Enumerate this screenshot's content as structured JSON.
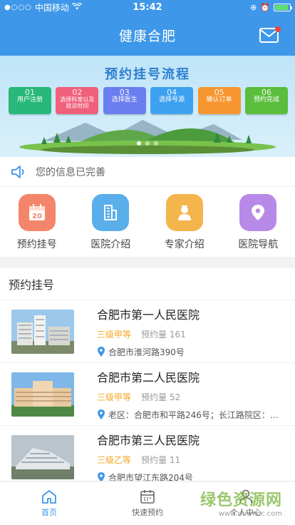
{
  "status_bar": {
    "signal": "●○○○",
    "carrier": "中国移动",
    "time": "15:42"
  },
  "header": {
    "title": "健康合肥"
  },
  "banner": {
    "title": "预约挂号流程",
    "steps": [
      {
        "num": "01",
        "label": "用户注册",
        "color": "#27b87a"
      },
      {
        "num": "02",
        "label": "选择科室以及就诊时间",
        "color": "#f0607a"
      },
      {
        "num": "03",
        "label": "选择医生",
        "color": "#6a7ef0"
      },
      {
        "num": "04",
        "label": "选择号源",
        "color": "#3da1f0"
      },
      {
        "num": "05",
        "label": "确认订单",
        "color": "#f79530"
      },
      {
        "num": "06",
        "label": "预约完成",
        "color": "#5bbd3c"
      }
    ]
  },
  "notice": {
    "text": "您的信息已完善"
  },
  "quick_menu": [
    {
      "label": "预约挂号",
      "icon": "calendar-icon",
      "color": "#f4856a"
    },
    {
      "label": "医院介绍",
      "icon": "building-icon",
      "color": "#5aaeea"
    },
    {
      "label": "专家介绍",
      "icon": "doctor-icon",
      "color": "#f4b54c"
    },
    {
      "label": "医院导航",
      "icon": "location-pin-icon",
      "color": "#b68ae6"
    }
  ],
  "section": {
    "title": "预约挂号",
    "hospitals": [
      {
        "name": "合肥市第一人民医院",
        "level": "三级甲等",
        "count_label": "预约量",
        "count": "161",
        "address": "合肥市淮河路390号"
      },
      {
        "name": "合肥市第二人民医院",
        "level": "三级甲等",
        "count_label": "预约量",
        "count": "52",
        "address": "老区：合肥市和平路246号；长江路院区：长..."
      },
      {
        "name": "合肥市第三人民医院",
        "level": "三级乙等",
        "count_label": "预约量",
        "count": "11",
        "address": "合肥市望江东路204号"
      }
    ]
  },
  "tabbar": [
    {
      "label": "首页",
      "active": true
    },
    {
      "label": "快速预约",
      "active": false
    },
    {
      "label": "个人中心",
      "active": false
    }
  ],
  "watermark": {
    "text": "绿色资源网",
    "url": "www.downcc.com"
  }
}
